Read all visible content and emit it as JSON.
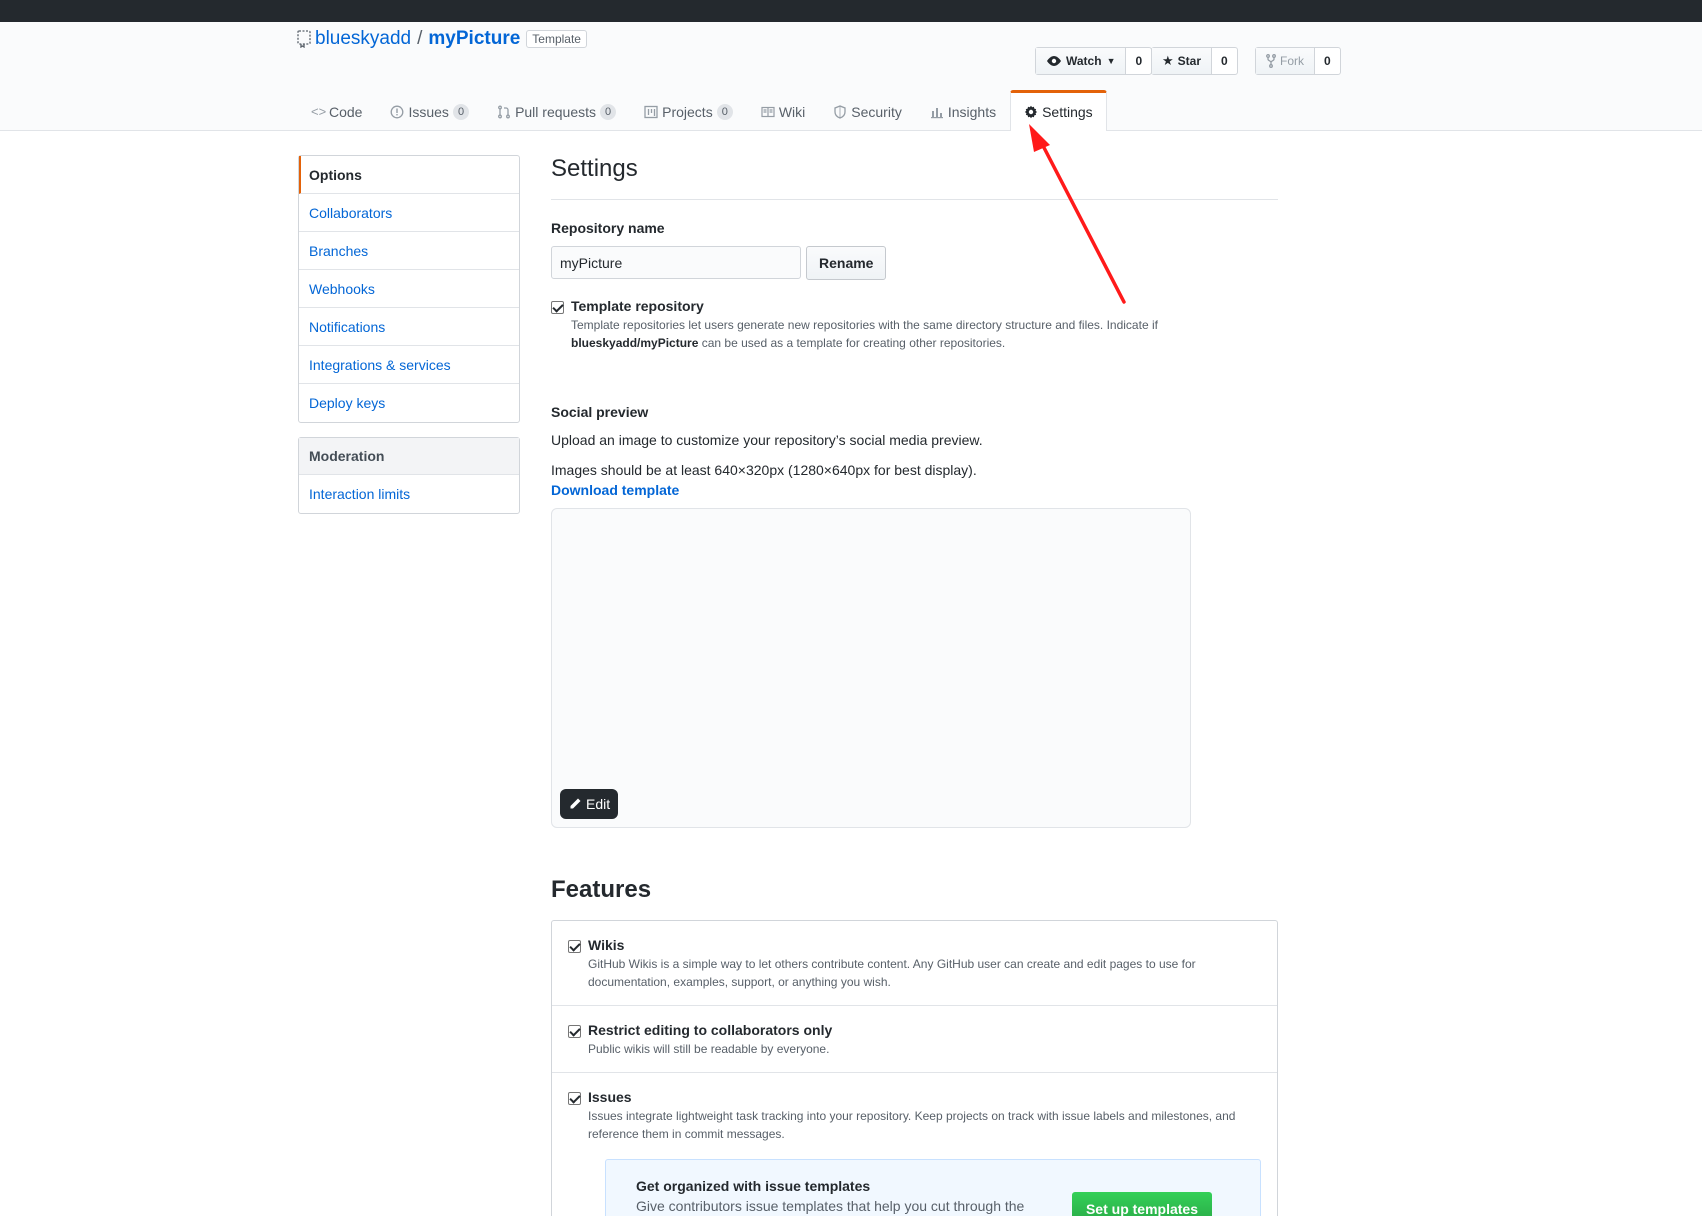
{
  "repo": {
    "owner": "blueskyadd",
    "separator": "/",
    "name": "myPicture",
    "badge": "Template"
  },
  "actions": {
    "watch": {
      "label": "Watch",
      "count": "0"
    },
    "star": {
      "label": "Star",
      "count": "0"
    },
    "fork": {
      "label": "Fork",
      "count": "0"
    }
  },
  "tabs": [
    {
      "label": "Code",
      "icon": "code-icon"
    },
    {
      "label": "Issues",
      "counter": "0",
      "icon": "issue-icon"
    },
    {
      "label": "Pull requests",
      "counter": "0",
      "icon": "pull-request-icon"
    },
    {
      "label": "Projects",
      "counter": "0",
      "icon": "project-icon"
    },
    {
      "label": "Wiki",
      "icon": "book-icon"
    },
    {
      "label": "Security",
      "icon": "shield-icon"
    },
    {
      "label": "Insights",
      "icon": "graph-icon"
    },
    {
      "label": "Settings",
      "icon": "gear-icon",
      "selected": true
    }
  ],
  "sidebar": {
    "items": [
      {
        "label": "Options"
      },
      {
        "label": "Collaborators"
      },
      {
        "label": "Branches"
      },
      {
        "label": "Webhooks"
      },
      {
        "label": "Notifications"
      },
      {
        "label": "Integrations & services"
      },
      {
        "label": "Deploy keys"
      }
    ],
    "moderation_heading": "Moderation",
    "moderation_items": [
      {
        "label": "Interaction limits"
      }
    ]
  },
  "settings": {
    "title": "Settings",
    "repo_name_label": "Repository name",
    "repo_name_value": "myPicture",
    "rename_button": "Rename",
    "template_repo": {
      "title": "Template repository",
      "note_part1": "Template repositories let users generate new repositories with the same directory structure and files. Indicate if",
      "note_bold": "blueskyadd/myPicture",
      "note_part2": "can be used as a template for creating other repositories."
    },
    "social_preview": {
      "title": "Social preview",
      "text1": "Upload an image to customize your repository’s social media preview.",
      "text2": "Images should be at least 640×320px (1280×640px for best display).",
      "download_link": "Download template",
      "edit_button": "Edit"
    }
  },
  "features": {
    "title": "Features",
    "items": [
      {
        "title": "Wikis",
        "note": "GitHub Wikis is a simple way to let others contribute content. Any GitHub user can create and edit pages to use for documentation, examples, support, or anything you wish."
      },
      {
        "title": "Restrict editing to collaborators only",
        "note": "Public wikis will still be readable by everyone."
      },
      {
        "title": "Issues",
        "note": "Issues integrate lightweight task tracking into your repository. Keep projects on track with issue labels and milestones, and reference them in commit messages."
      }
    ],
    "issue_templates": {
      "title": "Get organized with issue templates",
      "text": "Give contributors issue templates that help you cut through the",
      "button": "Set up templates"
    }
  },
  "colors": {
    "accent": "#e36209",
    "link": "#0366d6",
    "annotation_arrow": "#ff1a1a"
  }
}
